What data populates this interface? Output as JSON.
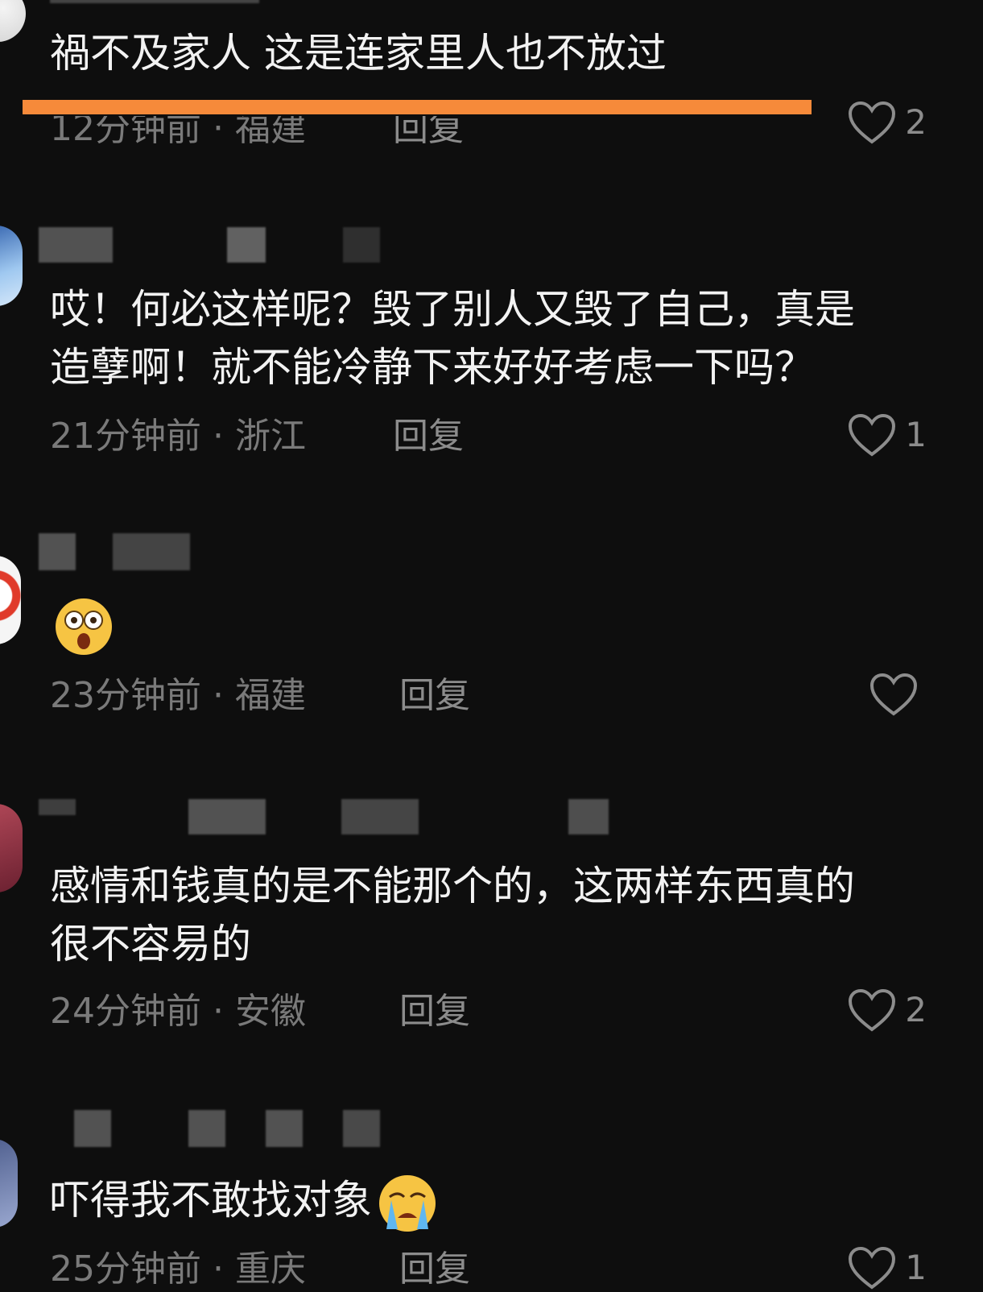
{
  "comments": [
    {
      "text": "禍不及家人 这是连家里人也不放过",
      "time": "12分钟前",
      "location": "福建",
      "reply": "回复",
      "likes": "2"
    },
    {
      "text_line1": "哎！何必这样呢？毁了别人又毁了自己，真是",
      "text_line2": "造孽啊！就不能冷静下来好好考虑一下吗？",
      "time": "21分钟前",
      "location": "浙江",
      "reply": "回复",
      "likes": "1"
    },
    {
      "emoji": "shocked-face",
      "time": "23分钟前",
      "location": "福建",
      "reply": "回复",
      "likes": ""
    },
    {
      "text_line1": "感情和钱真的是不能那个的，这两样东西真的",
      "text_line2": "很不容易的",
      "time": "24分钟前",
      "location": "安徽",
      "reply": "回复",
      "likes": "2"
    },
    {
      "text": "吓得我不敢找对象",
      "emoji": "crying-face",
      "time": "25分钟前",
      "location": "重庆",
      "reply": "回复",
      "likes": "1"
    }
  ],
  "separator": "·",
  "colors": {
    "background": "#0e0e0e",
    "text": "#f2f2f2",
    "meta": "#7a7a7a",
    "highlight_underline": "#f68a3a"
  }
}
